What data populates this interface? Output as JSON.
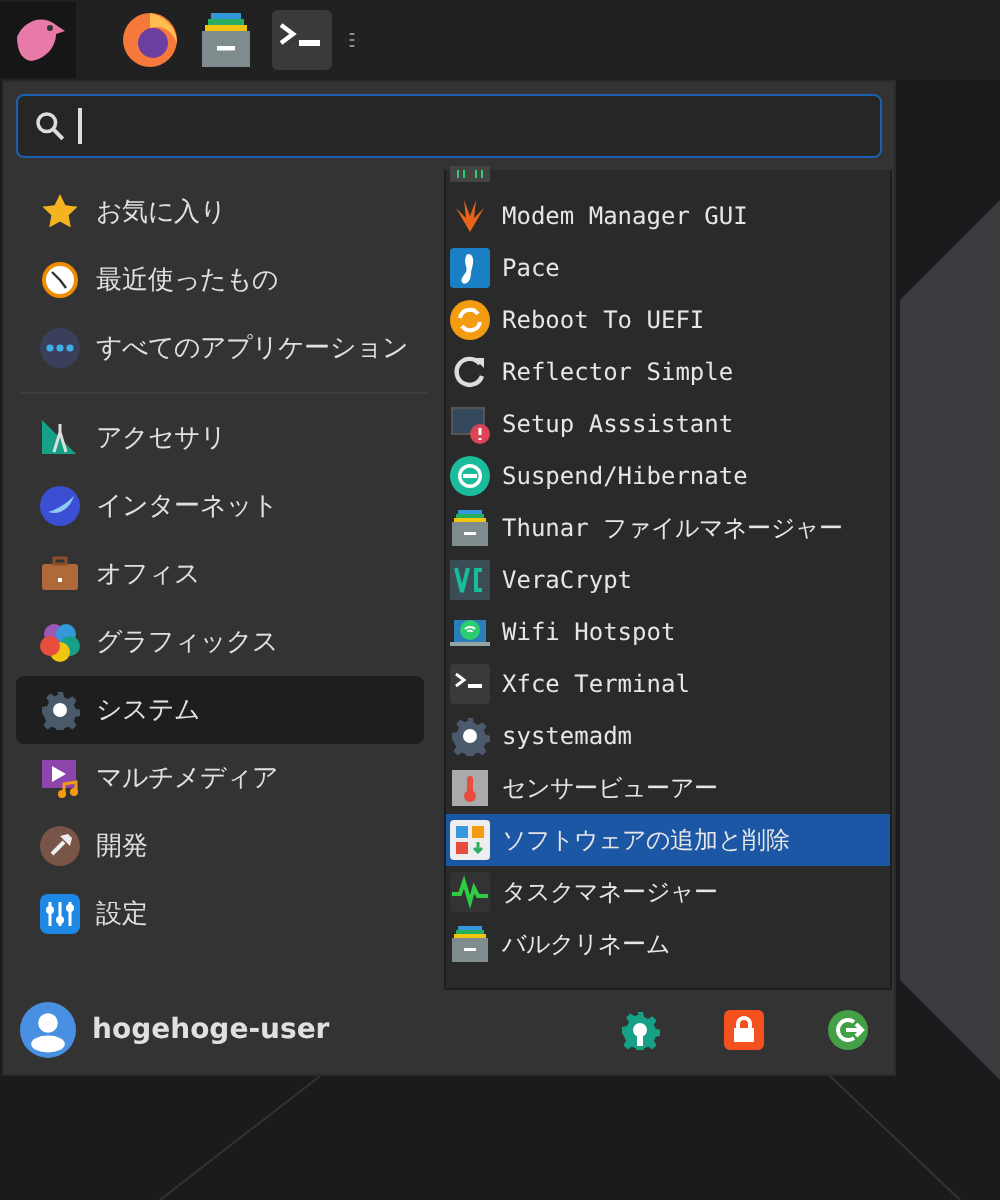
{
  "places": [
    {
      "label": "お気に入り",
      "selected": false
    },
    {
      "label": "最近使ったもの",
      "selected": false
    },
    {
      "label": "すべてのアプリケーション",
      "selected": false
    }
  ],
  "categories": [
    {
      "label": "アクセサリ",
      "selected": false
    },
    {
      "label": "インターネット",
      "selected": false
    },
    {
      "label": "オフィス",
      "selected": false
    },
    {
      "label": "グラフィックス",
      "selected": false
    },
    {
      "label": "システム",
      "selected": true
    },
    {
      "label": "マルチメディア",
      "selected": false
    },
    {
      "label": "開発",
      "selected": false
    },
    {
      "label": "設定",
      "selected": false
    }
  ],
  "apps": [
    {
      "label": "Modem Manager GUI",
      "selected": false
    },
    {
      "label": "Pace",
      "selected": false
    },
    {
      "label": "Reboot To UEFI",
      "selected": false
    },
    {
      "label": "Reflector Simple",
      "selected": false
    },
    {
      "label": "Setup Asssistant",
      "selected": false
    },
    {
      "label": "Suspend/Hibernate",
      "selected": false
    },
    {
      "label": "Thunar ファイルマネージャー",
      "selected": false
    },
    {
      "label": "VeraCrypt",
      "selected": false
    },
    {
      "label": "Wifi Hotspot",
      "selected": false
    },
    {
      "label": "Xfce Terminal",
      "selected": false
    },
    {
      "label": "systemadm",
      "selected": false
    },
    {
      "label": "センサービューアー",
      "selected": false
    },
    {
      "label": "ソフトウェアの追加と削除",
      "selected": true
    },
    {
      "label": "タスクマネージャー",
      "selected": false
    },
    {
      "label": "バルクリネーム",
      "selected": false
    }
  ],
  "user": {
    "name": "hogehoge-user"
  }
}
